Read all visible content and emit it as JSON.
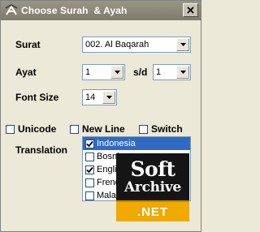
{
  "window": {
    "title": "Choose Surah  & Ayah",
    "close_label": "x"
  },
  "form": {
    "surat_label": "Surat",
    "surat_value": "002. Al Baqarah",
    "ayat_label": "Ayat",
    "ayat_from": "1",
    "sd_label": "s/d",
    "ayat_to": "1",
    "font_size_label": "Font Size",
    "font_size_value": "14"
  },
  "options": {
    "unicode_label": "Unicode",
    "unicode_checked": false,
    "newline_label": "New Line",
    "newline_checked": false,
    "switch_label": "Switch",
    "switch_checked": false
  },
  "translation": {
    "label": "Translation",
    "items": [
      {
        "label": "Indonesia",
        "checked": true,
        "selected": true
      },
      {
        "label": "Bosnian",
        "checked": false,
        "selected": false
      },
      {
        "label": "English",
        "checked": true,
        "selected": false
      },
      {
        "label": "French",
        "checked": false,
        "selected": false
      },
      {
        "label": "Malay",
        "checked": false,
        "selected": false
      }
    ]
  },
  "watermark": {
    "line1": "Soft",
    "line2": "Archive",
    "line3": ".NET"
  }
}
